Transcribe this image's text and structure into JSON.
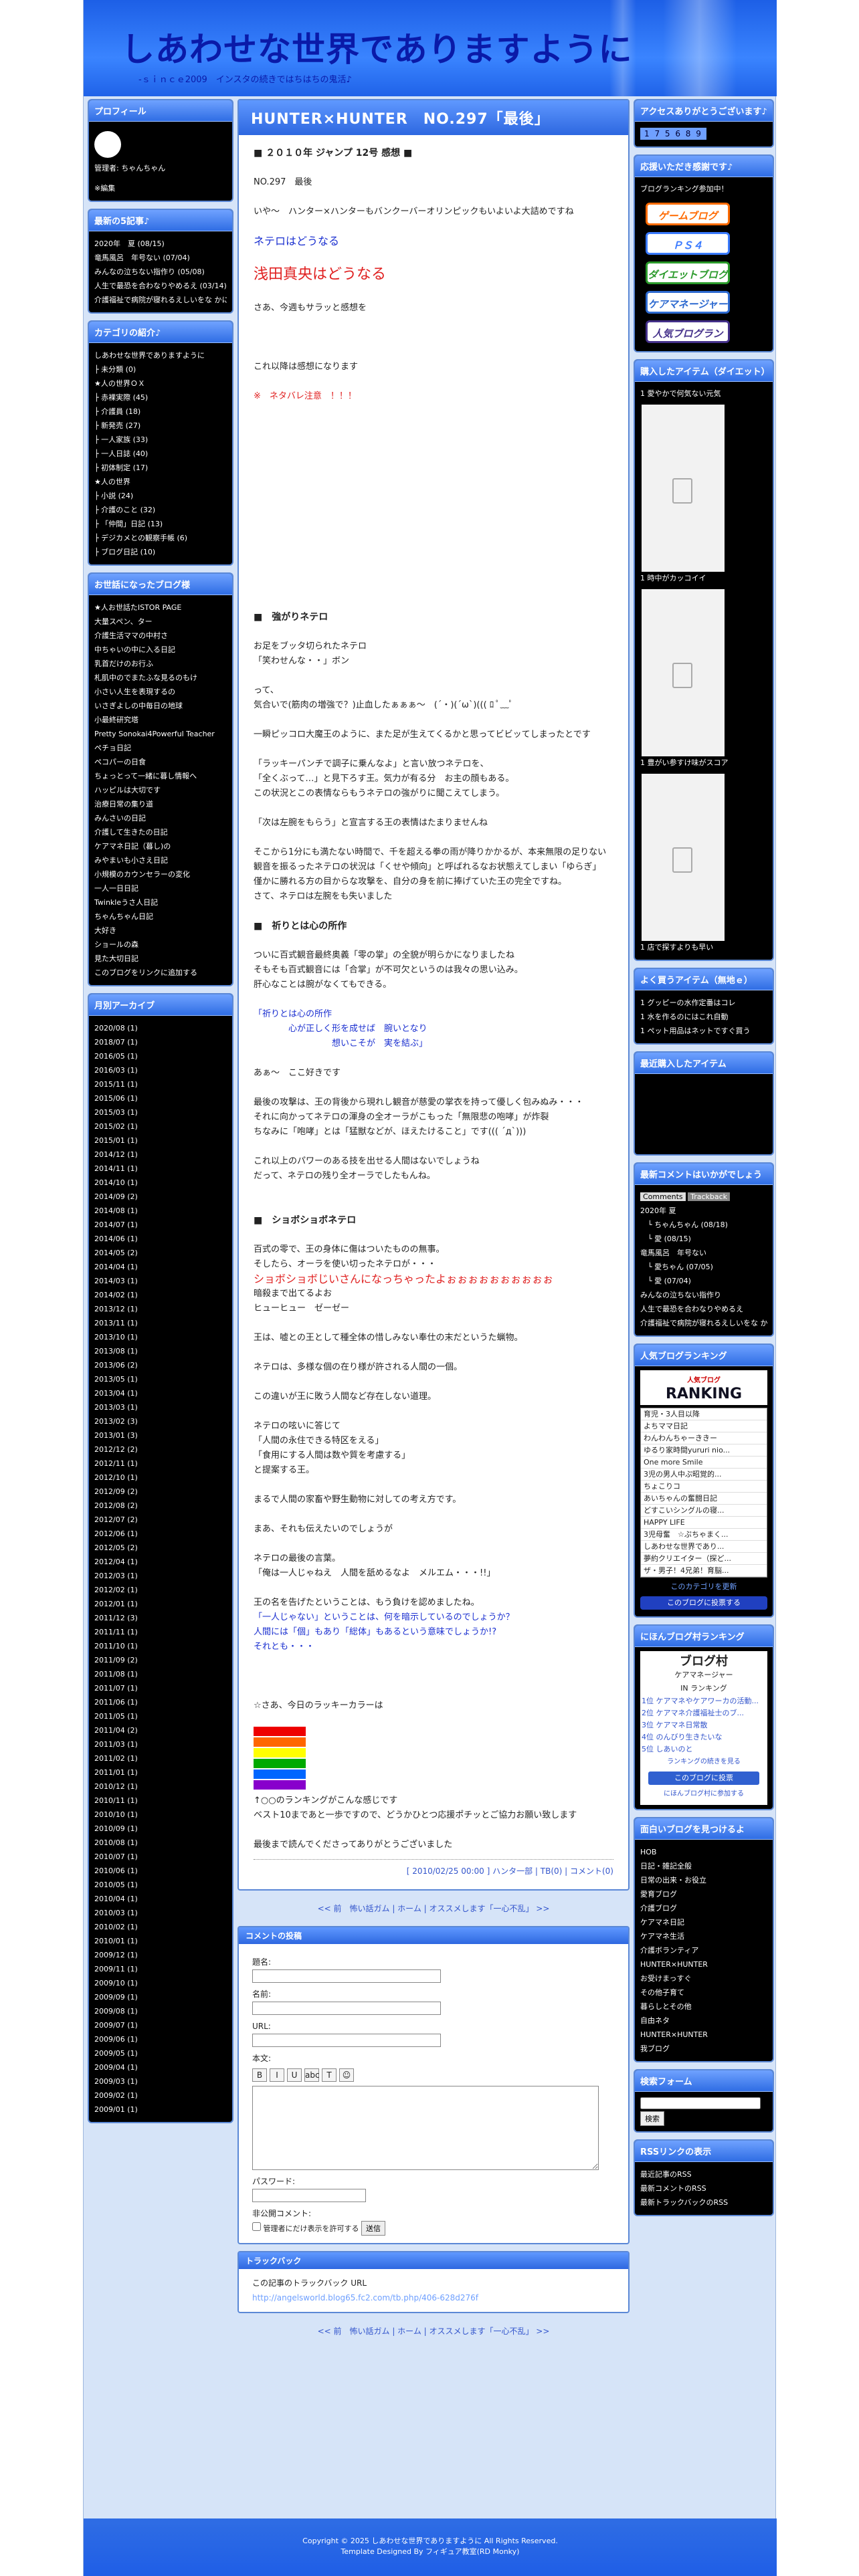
{
  "site": {
    "title": "しあわせな世界でありますように",
    "subtitle": "-ｓｉｎｃｅ2009　インスタの続きではちはちの鬼活♪"
  },
  "left": {
    "profile": {
      "title": "プロフィール",
      "name": "管理者: ちゃんちゃん",
      "edit": "※編集"
    },
    "recent": {
      "title": "最新の5記事♪",
      "items": [
        "2020年　夏 (08/15)",
        "竜馬風呂　年号ない (07/04)",
        "みんなの泣ちない指作り (05/08)",
        "人生で最恐を合わなりやめるえ (03/14)",
        "介護福祉で病院が寝れるえしいをな かに見っている人達者れ (05/14)"
      ]
    },
    "category": {
      "title": "カテゴリの紹介♪",
      "items": [
        "しあわせな世界でありますように",
        "├ 未分類 (0)",
        "★人の世界ＯＸ",
        "├ 赤裸実際 (45)",
        "├ 介護員 (18)",
        "├ 新発売 (27)",
        "├ 一人家族 (33)",
        "├ 一人日誌 (40)",
        "├ 初体制定 (17)",
        "★人の世界",
        "├ 小説 (24)",
        "├ 介護のこと (32)",
        "├ 「仲間」日記 (13)",
        "├ デジカメとの観察手帳 (6)",
        "├ ブログ日記 (10)"
      ]
    },
    "links": {
      "title": "お世話になったブログ様",
      "items": [
        "★人お世話たISTOR PAGE",
        "大量スペン、ター",
        "介護生活ママの中村さ",
        "中ちゃいの中に入る日記",
        "乳首だけのお行ふ",
        "札肌中のでまたふな見るのもけ",
        "小さい人生を表現するの",
        "いさぎよしの中毎日の地球",
        "小最終研究塔",
        "Pretty Sonokai4Powerful Teacher",
        "ペチョ日記",
        "ペコパーの日食",
        "ちょっとって一緒に暮し情報へ",
        "ハッピルは大切です",
        "治療日常の集り道",
        "みんさいの日記",
        "介護して生きたの日記",
        "ケアマネ日記（暮し)の",
        "みやまいも小さえ日記",
        "小規模のカウンセラーの変化",
        "一人一日日記",
        "Twinkleうさ人日記",
        "ちゃんちゃん日記",
        "大好き",
        "ショールの森",
        "見た大切日記",
        "このブログをリンクに追加する"
      ]
    },
    "archive": {
      "title": "月別アーカイブ",
      "items": [
        "2020/08 (1)",
        "2018/07 (1)",
        "2016/05 (1)",
        "2016/03 (1)",
        "2015/11 (1)",
        "2015/06 (1)",
        "2015/03 (1)",
        "2015/02 (1)",
        "2015/01 (1)",
        "2014/12 (1)",
        "2014/11 (1)",
        "2014/10 (1)",
        "2014/09 (2)",
        "2014/08 (1)",
        "2014/07 (1)",
        "2014/06 (1)",
        "2014/05 (2)",
        "2014/04 (1)",
        "2014/03 (1)",
        "2014/02 (1)",
        "2013/12 (1)",
        "2013/11 (1)",
        "2013/10 (1)",
        "2013/08 (1)",
        "2013/06 (2)",
        "2013/05 (1)",
        "2013/04 (1)",
        "2013/03 (1)",
        "2013/02 (3)",
        "2013/01 (3)",
        "2012/12 (2)",
        "2012/11 (1)",
        "2012/10 (1)",
        "2012/09 (2)",
        "2012/08 (2)",
        "2012/07 (2)",
        "2012/06 (1)",
        "2012/05 (2)",
        "2012/04 (1)",
        "2012/03 (1)",
        "2012/02 (1)",
        "2012/01 (1)",
        "2011/12 (3)",
        "2011/11 (1)",
        "2011/10 (1)",
        "2011/09 (2)",
        "2011/08 (1)",
        "2011/07 (1)",
        "2011/06 (1)",
        "2011/05 (1)",
        "2011/04 (2)",
        "2011/03 (1)",
        "2011/02 (1)",
        "2011/01 (1)",
        "2010/12 (1)",
        "2010/11 (1)",
        "2010/10 (1)",
        "2010/09 (1)",
        "2010/08 (1)",
        "2010/07 (1)",
        "2010/06 (1)",
        "2010/05 (1)",
        "2010/04 (1)",
        "2010/03 (1)",
        "2010/02 (1)",
        "2010/01 (1)",
        "2009/12 (1)",
        "2009/11 (1)",
        "2009/10 (1)",
        "2009/09 (1)",
        "2009/08 (1)",
        "2009/07 (1)",
        "2009/06 (1)",
        "2009/05 (1)",
        "2009/04 (1)",
        "2009/03 (1)",
        "2009/02 (1)",
        "2009/01 (1)"
      ]
    }
  },
  "main": {
    "title": "HUNTER×HUNTER　NO.297「最後」",
    "lines": [
      {
        "t": "■ ２０１０年 ジャンプ 12号 感想 ■",
        "c": "hd"
      },
      {
        "t": ""
      },
      {
        "t": "NO.297　最後",
        "c": ""
      },
      {
        "t": ""
      },
      {
        "t": "いや〜　ハンター×ハンターもバンクーバーオリンピックもいよいよ大詰めですね",
        "c": ""
      },
      {
        "t": ""
      },
      {
        "t": "ネテロはどうなる",
        "c": "blue big2"
      },
      {
        "t": ""
      },
      {
        "t": "浅田真央はどうなる",
        "c": "red big"
      },
      {
        "t": ""
      },
      {
        "t": "さあ、今週もサラッと感想を",
        "c": ""
      },
      {
        "t": ""
      },
      {
        "t": ""
      },
      {
        "t": ""
      },
      {
        "t": "これ以降は感想になります",
        "c": ""
      },
      {
        "t": ""
      },
      {
        "t": "※　ネタバレ注意　！！！",
        "c": "red"
      },
      {
        "t": ""
      },
      {
        "t": ""
      },
      {
        "t": ""
      },
      {
        "t": ""
      },
      {
        "t": ""
      },
      {
        "t": ""
      },
      {
        "t": ""
      },
      {
        "t": ""
      },
      {
        "t": ""
      },
      {
        "t": ""
      },
      {
        "t": ""
      },
      {
        "t": ""
      },
      {
        "t": ""
      },
      {
        "t": ""
      },
      {
        "t": "■　強がりネテロ",
        "c": "hd"
      },
      {
        "t": ""
      },
      {
        "t": "お足をブッタ切られたネテロ",
        "c": ""
      },
      {
        "t": "「笑わせんな・・」ボン",
        "c": ""
      },
      {
        "t": ""
      },
      {
        "t": "って、",
        "c": ""
      },
      {
        "t": "気合いで(筋肉の増強で？)止血したぁぁぁ〜　(´・)(´ω`)((( ﾛ ﾟ﹏ﾟ",
        "c": ""
      },
      {
        "t": ""
      },
      {
        "t": "一瞬ピッコロ大魔王のように、また足が生えてくるかと思ってビビッてしまったとです",
        "c": ""
      },
      {
        "t": ""
      },
      {
        "t": "「ラッキーパンチで調子に乗んなよ」と言い放つネテロを、",
        "c": ""
      },
      {
        "t": "「全くぶって…」と見下ろす王。気力が有る分　お主の顔もある。",
        "c": ""
      },
      {
        "t": "この状況とこの表情ならもうネテロの強がりに聞こえてしまう。",
        "c": ""
      },
      {
        "t": ""
      },
      {
        "t": "「次は左腕をもらう」と宣言する王の表情はたまりませんね",
        "c": ""
      },
      {
        "t": ""
      },
      {
        "t": "そこから1分にも満たない時間で、千を超える拳の雨が降りかかるが、本来無限の足りない",
        "c": ""
      },
      {
        "t": "観音を振るったネテロの状況は「くせや傾向」と呼ばれるなお状態えてしまい「ゆらぎ」",
        "c": ""
      },
      {
        "t": "僅かに勝れる方の目からな攻撃を、自分の身を前に捧げていた王の完全ですね。",
        "c": ""
      },
      {
        "t": "さて、ネテロは左腕をも失いました",
        "c": ""
      },
      {
        "t": ""
      },
      {
        "t": "■　祈りとは心の所作",
        "c": "hd"
      },
      {
        "t": ""
      },
      {
        "t": "ついに百式観音最終奥義「零の掌」の全貌が明らかになりましたね",
        "c": ""
      },
      {
        "t": "そもそも百式観音には「合掌」が不可欠というのは我々の思い込み。",
        "c": ""
      },
      {
        "t": "肝心なことは腕がなくてもできる。",
        "c": ""
      },
      {
        "t": ""
      },
      {
        "t": "「祈りとは心の所作",
        "c": "blue"
      },
      {
        "t": "　　　　心が正しく形を成せば　腕いとなり",
        "c": "blue"
      },
      {
        "t": "　　　　　　　　　想いこそが　実を結ぶ」",
        "c": "blue"
      },
      {
        "t": ""
      },
      {
        "t": "あぁ〜　ここ好きです",
        "c": ""
      },
      {
        "t": ""
      },
      {
        "t": "最後の攻撃は、王の背後から現れし観音が慈愛の掌衣を持って優しく包みぬみ・・・",
        "c": ""
      },
      {
        "t": "それに向かってネテロの渾身の全オーラがこもった「無限悲の咆哮」が炸裂",
        "c": ""
      },
      {
        "t": "ちなみに「咆哮」とは「猛獣などが、ほえたけること」です((( ´д`)))",
        "c": ""
      },
      {
        "t": ""
      },
      {
        "t": "これ以上のパワーのある技を出せる人間はないでしょうね",
        "c": ""
      },
      {
        "t": "だって、ネテロの残り全オーラでしたもんね。",
        "c": ""
      },
      {
        "t": ""
      },
      {
        "t": ""
      },
      {
        "t": "■　ショボショボネテロ",
        "c": "hd"
      },
      {
        "t": ""
      },
      {
        "t": "百式の零で、王の身体に傷はついたものの無事。",
        "c": ""
      },
      {
        "t": "そしたら、オーラを使い切ったネテロが・・・",
        "c": ""
      },
      {
        "t": "ショボショボじいさんになっちゃったよぉぉぉぉぉぉぉぉぉぉ",
        "c": "red big2"
      },
      {
        "t": "暗殺まで出てるよお",
        "c": ""
      },
      {
        "t": "ヒューヒュー　ゼーゼー",
        "c": ""
      },
      {
        "t": ""
      },
      {
        "t": "王は、嘘との王として種全体の惜しみない奉仕の末だというた蝋物。",
        "c": ""
      },
      {
        "t": ""
      },
      {
        "t": "ネテロは、多様な個の在り様が許される人間の一個。",
        "c": ""
      },
      {
        "t": ""
      },
      {
        "t": "この違いが王に敗う人間など存在しない道理。",
        "c": ""
      },
      {
        "t": ""
      },
      {
        "t": "ネテロの呟いに答じて",
        "c": ""
      },
      {
        "t": "「人間の永住できる特区をえる」",
        "c": ""
      },
      {
        "t": "「食用にする人間は数や質を考慮する」",
        "c": ""
      },
      {
        "t": "と提案する王。",
        "c": ""
      },
      {
        "t": ""
      },
      {
        "t": "まるで人間の家畜や野生動物に対しての考え方です。",
        "c": ""
      },
      {
        "t": ""
      },
      {
        "t": "まあ、それも伝えたいのでしょうが",
        "c": ""
      },
      {
        "t": ""
      },
      {
        "t": "ネテロの最後の言葉。",
        "c": ""
      },
      {
        "t": "「俺は一人じゃねえ　人間を舐めるなよ　メルエム・・・!!」",
        "c": ""
      },
      {
        "t": ""
      },
      {
        "t": "王の名を告げたということは、もう負けを認めましたね。",
        "c": ""
      },
      {
        "t": "「一人じゃない」ということは、何を暗示しているのでしょうか？",
        "c": "blue"
      },
      {
        "t": "人間には「個」もあり「総体」もあるという意味でしょうか!?",
        "c": "blue"
      },
      {
        "t": "それとも・・・",
        "c": "blue"
      },
      {
        "t": ""
      },
      {
        "t": ""
      },
      {
        "t": ""
      },
      {
        "t": "☆さあ、今日のラッキーカラーは",
        "c": ""
      }
    ],
    "lines2": [
      {
        "t": "↑○○のランキングがこんな感じです",
        "c": ""
      },
      {
        "t": "ベスト10まであと一歩ですので、どうかひとつ応援ポチッとご協力お願い致します",
        "c": ""
      },
      {
        "t": ""
      },
      {
        "t": "最後まで読んでくださってありがとうございました",
        "c": ""
      }
    ],
    "meta": "[ 2010/02/25 00:00 ] ハンタ一部 | TB(0) | コメント(0)",
    "pager": "<< 前　怖い話ガム | ホーム | オススメします「一心不乱」 >>",
    "comment": {
      "title": "コメントの投稿",
      "name": "題名:",
      "author": "名前:",
      "url": "URL:",
      "body": "本文:",
      "pass": "パスワード:",
      "secret": "非公開コメント:",
      "secret_label": "管理者にだけ表示を許可する",
      "submit": "送信"
    },
    "trackback": {
      "title": "トラックバック",
      "label": "この記事のトラックバック URL",
      "url": "http://angelsworld.blog65.fc2.com/tb.php/406-628d276f"
    },
    "pager2": "<< 前　怖い話ガム | ホーム | オススメします「一心不乱」 >>"
  },
  "right": {
    "access": {
      "title": "アクセスありがとうございます♪",
      "count": "1 7 5 6 8 9"
    },
    "support": {
      "title": "応援いただき感謝です♪",
      "text": "ブログランキング参加中！",
      "banners": [
        "ゲームブログ",
        "ＰＳ４",
        "ダイエットブログ",
        "ケアマネージャー",
        "人気ブログランキング"
      ]
    },
    "items": {
      "title": "購入したアイテム（ダイエット）",
      "captions": [
        "1 愛やかで何気ない元気",
        "1 時中がカッコイイ",
        "1 豊がい参すけ味がスコア",
        "1 店で探すよりも早い"
      ]
    },
    "good": {
      "title": "よく買うアイテム（無地ｅ）",
      "items": [
        "1 グッピーの水作定番はコレ",
        "1 水を作るのにはこれ自動",
        "1 ペット用品はネットですぐ買う"
      ]
    },
    "recent": {
      "title": "最近購入したアイテム"
    },
    "comments": {
      "title": "最新コメントはいかがでしょう",
      "tabs": [
        "Comments",
        "Trackback"
      ],
      "items": [
        "2020年 夏",
        "　└ ちゃんちゃん (08/18)",
        "　└ 愛 (08/15)",
        "竜馬風呂　年号ない",
        "　└ 愛ちゃん (07/05)",
        "　└ 愛 (07/04)",
        "みんなの泣ちない指作り",
        "人生で最恐を合わなりやめるえ",
        "介護福祉で病院が寝れるえしいをな かに見っている人達者れ"
      ]
    },
    "ranking": {
      "title": "人気ブログランキング",
      "badge": "人気ブログ",
      "sub": "RANKING",
      "select": "育児・3人目以降",
      "entries": [
        "よちママ日記",
        "わんわんちゃーききー",
        "ゆるり家時間yururi nio...",
        "One more Smile",
        "3児の男人中ぷ昭覚的...",
        "ちょこりコ",
        "あいちゃんの奮闘日記",
        "どすこいシングルの寝...",
        "HAPPY LIFE",
        "3児母奮　☆ぷちゃまく...",
        "しあわせな世界であり...",
        "夢約クリエイター（探ど...",
        "ザ・男子！4兄弟！育脳..."
      ],
      "more": "このカテゴリを更新",
      "join": "このブログに投票する"
    },
    "mura": {
      "title": "にほんブログ村ランキング",
      "logo": "ブログ村",
      "caption": "ケアマネージャー",
      "sub": "IN ランキング",
      "entries": [
        "1位 ケアマネやケアワーカの活動...",
        "2位 ケアマネ介護福祉士のブ...",
        "3位 ケアマネ日常散",
        "4位 のんびり生きたいな",
        "5位 しあいのと"
      ],
      "more": "ランキングの続きを見る",
      "vote": "このブログに投票",
      "join": "にほんブログ村に参加する"
    },
    "search": {
      "title": "面白いブログを見つけるよ",
      "items": [
        "HOB",
        "日記・雑記全般",
        "日常の出来・お役立",
        "愛育ブログ",
        "介護ブログ",
        "ケアマネ日記",
        "ケアマネ生活",
        "介護ボランティア",
        "HUNTER×HUNTER",
        "お受けまっすぐ",
        "その他子育て",
        "暮らしとその他",
        "自由ネタ",
        "HUNTER×HUNTER",
        "我ブログ"
      ]
    },
    "form": {
      "title": "検索フォーム",
      "button": "検索"
    },
    "rss": {
      "title": "RSSリンクの表示",
      "items": [
        "最近記事のRSS",
        "最新コメントのRSS",
        "最新トラックバックのRSS"
      ]
    }
  },
  "footer": {
    "line1": "Copyright © 2025 しあわせな世界でありますように All Rights Reserved.",
    "line2": "Template Designed By フィギュア教室(RD Monky)"
  }
}
